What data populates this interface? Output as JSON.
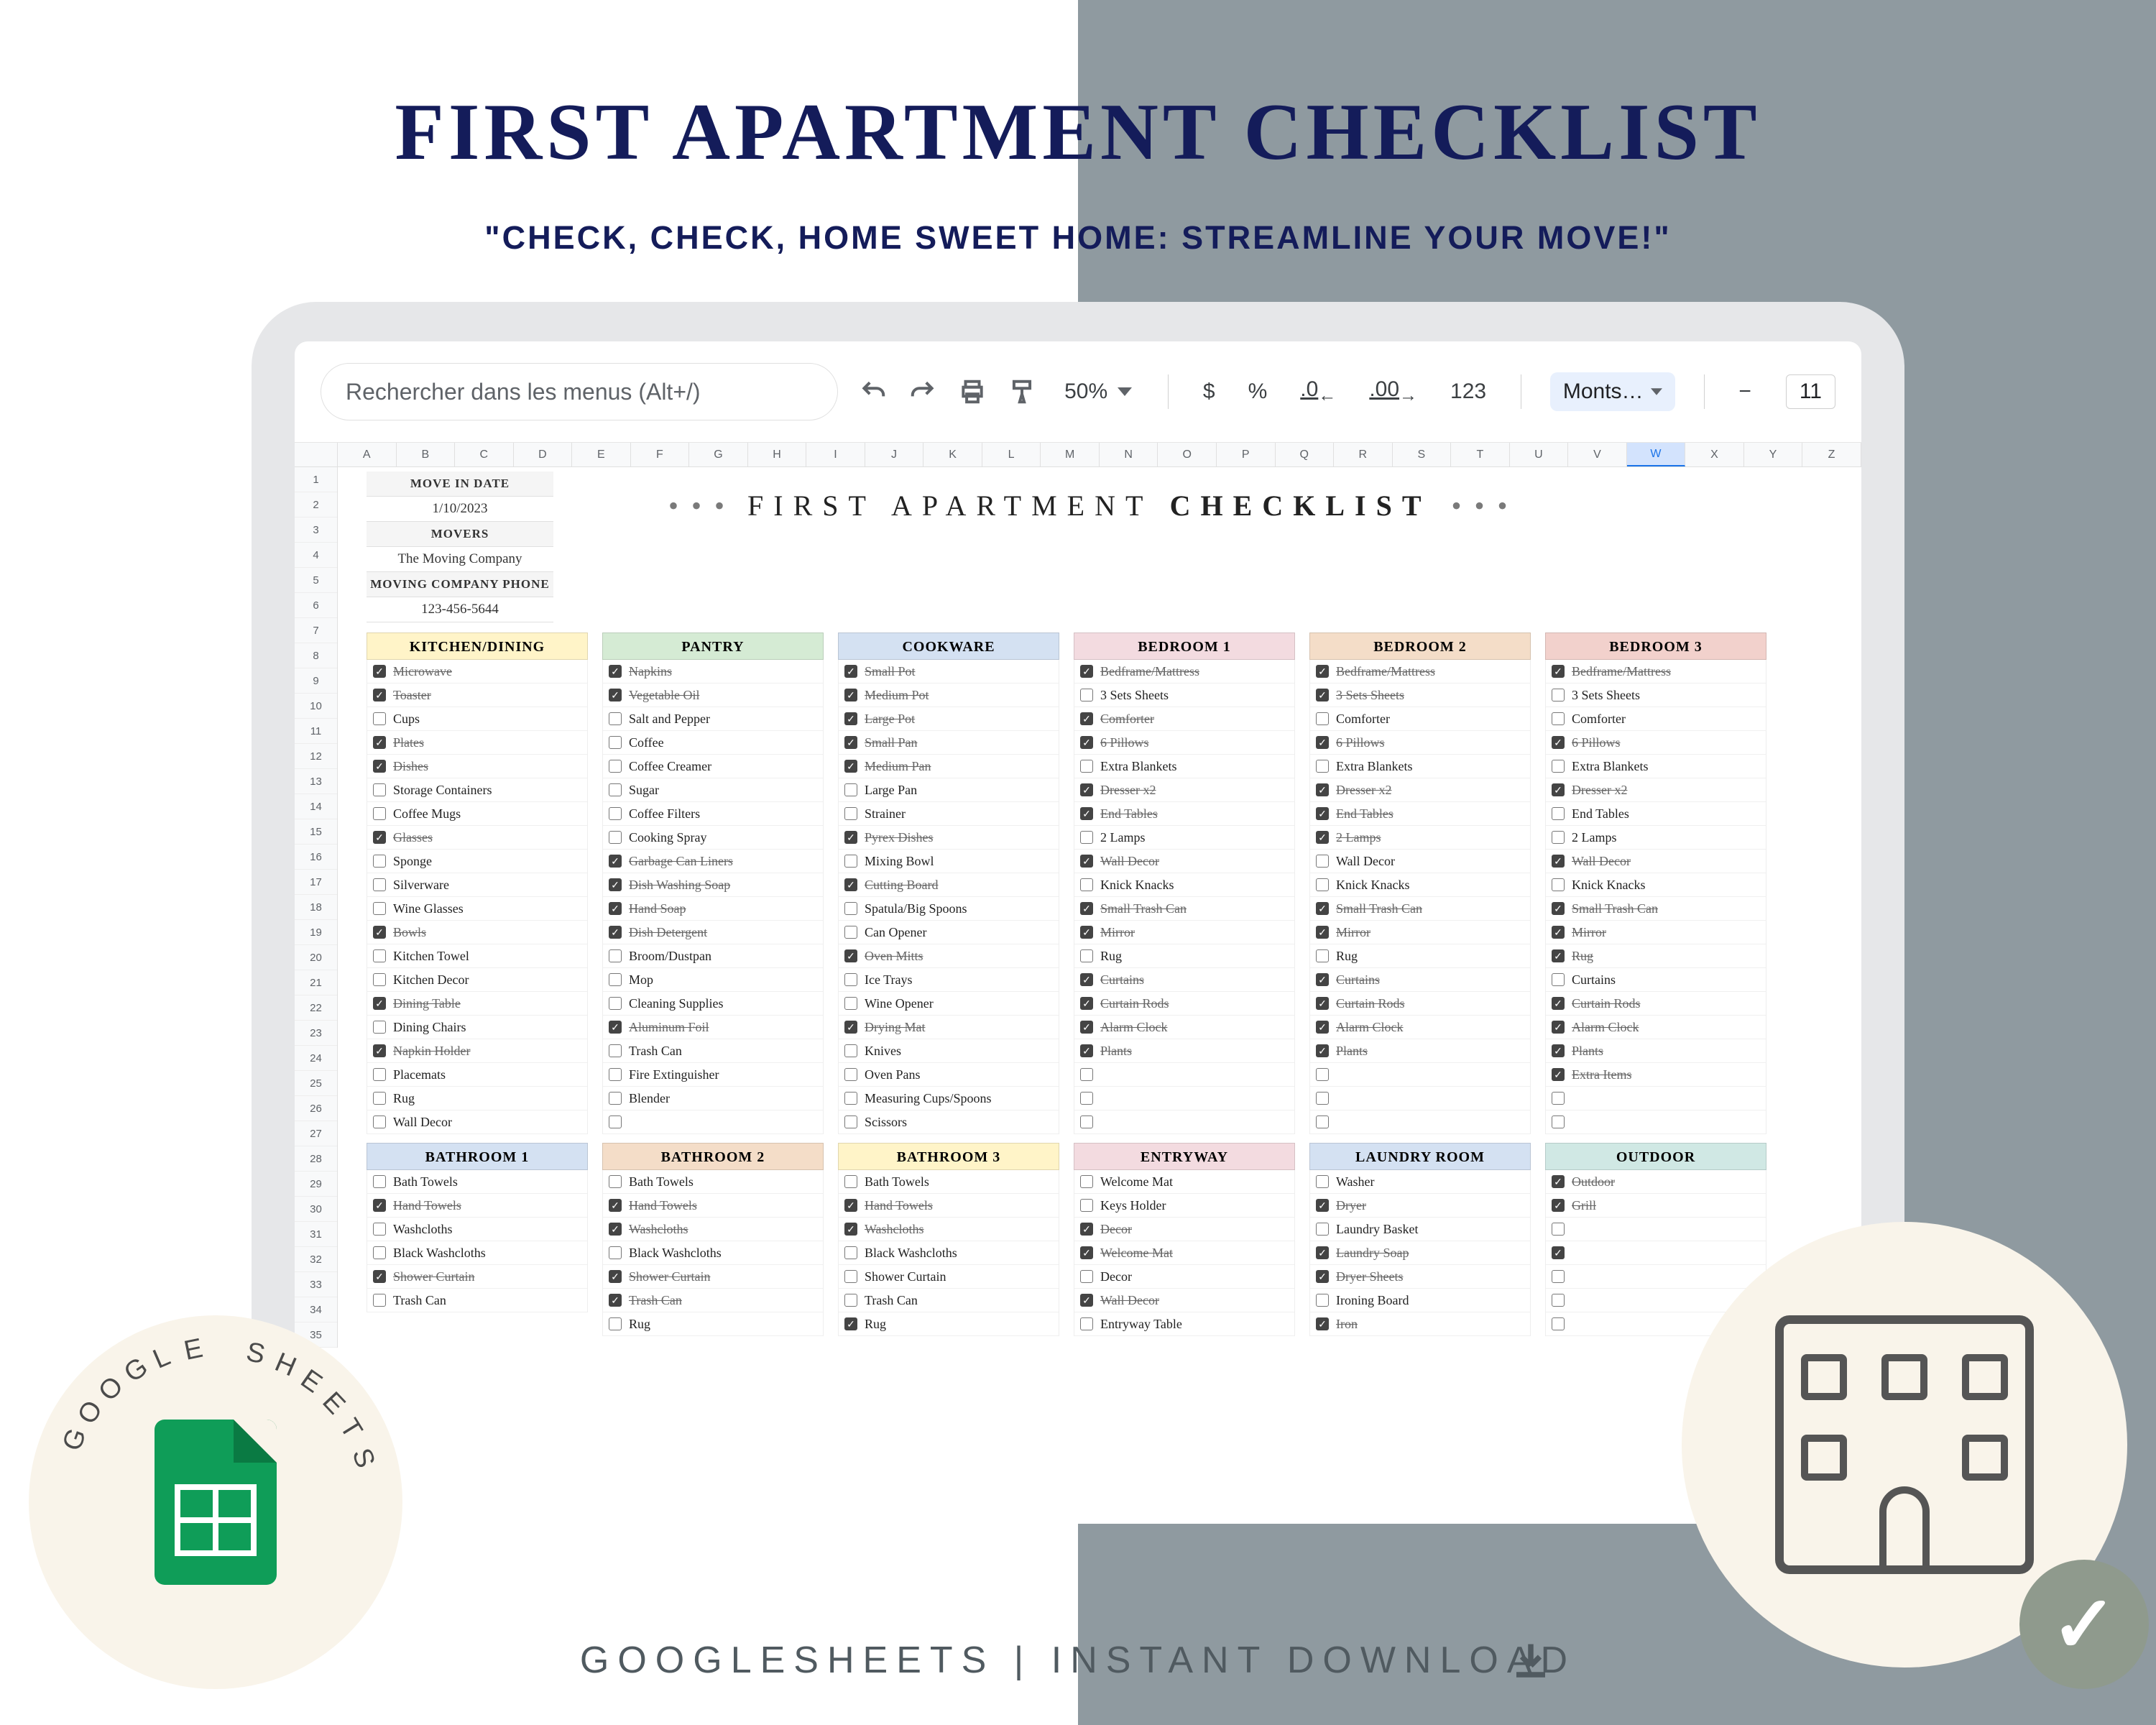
{
  "hero": {
    "title": "FIRST APARTMENT CHECKLIST",
    "subtitle": "\"CHECK, CHECK, HOME SWEET HOME: STREAMLINE YOUR MOVE!\""
  },
  "footer": "GOOGLESHEETS | INSTANT DOWNLOAD",
  "badge_left_text": "GOOGLE SHEETS",
  "toolbar": {
    "search_placeholder": "Rechercher dans les menus (Alt+/)",
    "zoom": "50%",
    "currency": "$",
    "percent": "%",
    "dec_dec": ".0",
    "dec_inc": ".00",
    "num123": "123",
    "font": "Monts…",
    "minus": "−",
    "size": "11"
  },
  "columns": [
    "A",
    "B",
    "C",
    "D",
    "E",
    "F",
    "G",
    "H",
    "I",
    "J",
    "K",
    "L",
    "M",
    "N",
    "O",
    "P",
    "Q",
    "R",
    "S",
    "T",
    "U",
    "V",
    "W",
    "X",
    "Y",
    "Z"
  ],
  "selected_col": "W",
  "rows": 35,
  "meta": [
    {
      "label": "MOVE IN DATE",
      "value": "1/10/2023"
    },
    {
      "label": "MOVERS",
      "value": "The Moving Company"
    },
    {
      "label": "Moving Company Phone",
      "value": "123-456-5644"
    }
  ],
  "sheet_title_pre": "FIRST APARTMENT ",
  "sheet_title_bold": "CHECKLIST",
  "colors": {
    "yellow": "#fff4c8",
    "green": "#d5ebd4",
    "blue": "#d4e1f2",
    "pink": "#f3dbe0",
    "orange": "#f4ddc8",
    "red": "#f2d1cc",
    "teal": "#d0e8e4"
  },
  "row1": [
    {
      "title": "KITCHEN/DINING",
      "color": "yellow",
      "items": [
        [
          "Microwave",
          1,
          1
        ],
        [
          "Toaster",
          1,
          1
        ],
        [
          "Cups",
          0,
          0
        ],
        [
          "Plates",
          1,
          1
        ],
        [
          "Dishes",
          1,
          1
        ],
        [
          "Storage Containers",
          0,
          0
        ],
        [
          "Coffee Mugs",
          0,
          0
        ],
        [
          "Glasses",
          1,
          1
        ],
        [
          "Sponge",
          0,
          0
        ],
        [
          "Silverware",
          0,
          0
        ],
        [
          "Wine Glasses",
          0,
          0
        ],
        [
          "Bowls",
          1,
          1
        ],
        [
          "Kitchen Towel",
          0,
          0
        ],
        [
          "Kitchen Decor",
          0,
          0
        ],
        [
          "Dining Table",
          1,
          1
        ],
        [
          "Dining Chairs",
          0,
          0
        ],
        [
          "Napkin Holder",
          1,
          1
        ],
        [
          "Placemats",
          0,
          0
        ],
        [
          "Rug",
          0,
          0
        ],
        [
          "Wall Decor",
          0,
          0
        ]
      ]
    },
    {
      "title": "PANTRY",
      "color": "green",
      "items": [
        [
          "Napkins",
          1,
          1
        ],
        [
          "Vegetable Oil",
          1,
          1
        ],
        [
          "Salt and Pepper",
          0,
          0
        ],
        [
          "Coffee",
          0,
          0
        ],
        [
          "Coffee Creamer",
          0,
          0
        ],
        [
          "Sugar",
          0,
          0
        ],
        [
          "Coffee Filters",
          0,
          0
        ],
        [
          "Cooking Spray",
          0,
          0
        ],
        [
          "Garbage Can Liners",
          1,
          1
        ],
        [
          "Dish Washing Soap",
          1,
          1
        ],
        [
          "Hand Soap",
          1,
          1
        ],
        [
          "Dish Detergent",
          1,
          1
        ],
        [
          "Broom/Dustpan",
          0,
          0
        ],
        [
          "Mop",
          0,
          0
        ],
        [
          "Cleaning Supplies",
          0,
          0
        ],
        [
          "Aluminum Foil",
          1,
          1
        ],
        [
          "Trash Can",
          0,
          0
        ],
        [
          "Fire Extinguisher",
          0,
          0
        ],
        [
          "Blender",
          0,
          0
        ],
        [
          "",
          0,
          0
        ]
      ]
    },
    {
      "title": "COOKWARE",
      "color": "blue",
      "items": [
        [
          "Small Pot",
          1,
          1
        ],
        [
          "Medium Pot",
          1,
          1
        ],
        [
          "Large Pot",
          1,
          1
        ],
        [
          "Small Pan",
          1,
          1
        ],
        [
          "Medium Pan",
          1,
          1
        ],
        [
          "Large Pan",
          0,
          0
        ],
        [
          "Strainer",
          0,
          0
        ],
        [
          "Pyrex Dishes",
          1,
          1
        ],
        [
          "Mixing Bowl",
          0,
          0
        ],
        [
          "Cutting Board",
          1,
          1
        ],
        [
          "Spatula/Big Spoons",
          0,
          0
        ],
        [
          "Can Opener",
          0,
          0
        ],
        [
          "Oven Mitts",
          1,
          1
        ],
        [
          "Ice Trays",
          0,
          0
        ],
        [
          "Wine Opener",
          0,
          0
        ],
        [
          "Drying Mat",
          1,
          1
        ],
        [
          "Knives",
          0,
          0
        ],
        [
          "Oven Pans",
          0,
          0
        ],
        [
          "Measuring Cups/Spoons",
          0,
          0
        ],
        [
          "Scissors",
          0,
          0
        ]
      ]
    },
    {
      "title": "BEDROOM 1",
      "color": "pink",
      "items": [
        [
          "Bedframe/Mattress",
          1,
          1
        ],
        [
          "3 Sets Sheets",
          0,
          0
        ],
        [
          "Comforter",
          1,
          1
        ],
        [
          "6 Pillows",
          1,
          1
        ],
        [
          "Extra Blankets",
          0,
          0
        ],
        [
          "Dresser x2",
          1,
          1
        ],
        [
          "End Tables",
          1,
          1
        ],
        [
          "2 Lamps",
          0,
          0
        ],
        [
          "Wall Decor",
          1,
          1
        ],
        [
          "Knick Knacks",
          0,
          0
        ],
        [
          "Small Trash Can",
          1,
          1
        ],
        [
          "Mirror",
          1,
          1
        ],
        [
          "Rug",
          0,
          0
        ],
        [
          "Curtains",
          1,
          1
        ],
        [
          "Curtain Rods",
          1,
          1
        ],
        [
          "Alarm Clock",
          1,
          1
        ],
        [
          "Plants",
          1,
          1
        ],
        [
          "",
          0,
          0
        ],
        [
          "",
          0,
          0
        ],
        [
          "",
          0,
          0
        ]
      ]
    },
    {
      "title": "BEDROOM 2",
      "color": "orange",
      "items": [
        [
          "Bedframe/Mattress",
          1,
          1
        ],
        [
          "3 Sets Sheets",
          1,
          1
        ],
        [
          "Comforter",
          0,
          0
        ],
        [
          "6 Pillows",
          1,
          1
        ],
        [
          "Extra Blankets",
          0,
          0
        ],
        [
          "Dresser x2",
          1,
          1
        ],
        [
          "End Tables",
          1,
          1
        ],
        [
          "2 Lamps",
          1,
          1
        ],
        [
          "Wall Decor",
          0,
          0
        ],
        [
          "Knick Knacks",
          0,
          0
        ],
        [
          "Small Trash Can",
          1,
          1
        ],
        [
          "Mirror",
          1,
          1
        ],
        [
          "Rug",
          0,
          0
        ],
        [
          "Curtains",
          1,
          1
        ],
        [
          "Curtain Rods",
          1,
          1
        ],
        [
          "Alarm Clock",
          1,
          1
        ],
        [
          "Plants",
          1,
          1
        ],
        [
          "",
          0,
          0
        ],
        [
          "",
          0,
          0
        ],
        [
          "",
          0,
          0
        ]
      ]
    },
    {
      "title": "BEDROOM 3",
      "color": "red",
      "items": [
        [
          "Bedframe/Mattress",
          1,
          1
        ],
        [
          "3 Sets Sheets",
          0,
          0
        ],
        [
          "Comforter",
          0,
          0
        ],
        [
          "6 Pillows",
          1,
          1
        ],
        [
          "Extra Blankets",
          0,
          0
        ],
        [
          "Dresser x2",
          1,
          1
        ],
        [
          "End Tables",
          0,
          0
        ],
        [
          "2 Lamps",
          0,
          0
        ],
        [
          "Wall Decor",
          1,
          1
        ],
        [
          "Knick Knacks",
          0,
          0
        ],
        [
          "Small Trash Can",
          1,
          1
        ],
        [
          "Mirror",
          1,
          1
        ],
        [
          "Rug",
          1,
          1
        ],
        [
          "Curtains",
          0,
          0
        ],
        [
          "Curtain Rods",
          1,
          1
        ],
        [
          "Alarm Clock",
          1,
          1
        ],
        [
          "Plants",
          1,
          1
        ],
        [
          "Extra Items",
          1,
          1
        ],
        [
          "",
          0,
          0
        ],
        [
          "",
          0,
          0
        ]
      ]
    }
  ],
  "row2": [
    {
      "title": "BATHROOM 1",
      "color": "blue",
      "items": [
        [
          "Bath Towels",
          0,
          0
        ],
        [
          "Hand Towels",
          1,
          1
        ],
        [
          "Washcloths",
          0,
          0
        ],
        [
          "Black Washcloths",
          0,
          0
        ],
        [
          "Shower Curtain",
          1,
          1
        ],
        [
          "Trash Can",
          0,
          0
        ]
      ]
    },
    {
      "title": "BATHROOM 2",
      "color": "orange",
      "items": [
        [
          "Bath Towels",
          0,
          0
        ],
        [
          "Hand Towels",
          1,
          1
        ],
        [
          "Washcloths",
          1,
          1
        ],
        [
          "Black Washcloths",
          0,
          0
        ],
        [
          "Shower Curtain",
          1,
          1
        ],
        [
          "Trash Can",
          1,
          1
        ],
        [
          "Rug",
          0,
          0
        ]
      ]
    },
    {
      "title": "BATHROOM 3",
      "color": "yellow",
      "items": [
        [
          "Bath Towels",
          0,
          0
        ],
        [
          "Hand Towels",
          1,
          1
        ],
        [
          "Washcloths",
          1,
          1
        ],
        [
          "Black Washcloths",
          0,
          0
        ],
        [
          "Shower Curtain",
          0,
          0
        ],
        [
          "Trash Can",
          0,
          0
        ],
        [
          "Rug",
          1,
          0
        ]
      ]
    },
    {
      "title": "ENTRYWAY",
      "color": "pink",
      "items": [
        [
          "Welcome Mat",
          0,
          0
        ],
        [
          "Keys Holder",
          0,
          0
        ],
        [
          "Decor",
          1,
          1
        ],
        [
          "Welcome Mat",
          1,
          1
        ],
        [
          "Decor",
          0,
          0
        ],
        [
          "Wall Decor",
          1,
          1
        ],
        [
          "Entryway Table",
          0,
          0
        ]
      ]
    },
    {
      "title": "LAUNDRY ROOM",
      "color": "blue",
      "items": [
        [
          "Washer",
          0,
          0
        ],
        [
          "Dryer",
          1,
          1
        ],
        [
          "Laundry Basket",
          0,
          0
        ],
        [
          "Laundry Soap",
          1,
          1
        ],
        [
          "Dryer Sheets",
          1,
          1
        ],
        [
          "Ironing Board",
          0,
          0
        ],
        [
          "Iron",
          1,
          1
        ]
      ]
    },
    {
      "title": "OUTDOOR",
      "color": "teal",
      "items": [
        [
          "Outdoor",
          1,
          1
        ],
        [
          "Grill",
          1,
          1
        ],
        [
          "",
          0,
          0
        ],
        [
          "",
          1,
          0
        ],
        [
          "",
          0,
          0
        ],
        [
          "",
          0,
          0
        ],
        [
          "",
          0,
          0
        ]
      ]
    }
  ]
}
